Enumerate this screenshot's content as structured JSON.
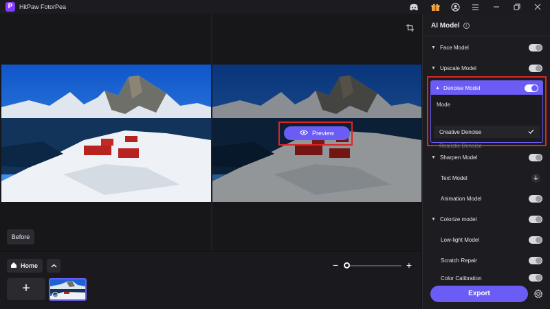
{
  "app": {
    "logo_letter": "P",
    "title": "HitPaw FotorPea"
  },
  "titlebar": {
    "icons": [
      "discord-icon",
      "gift-icon",
      "account-icon",
      "menu-icon",
      "minimize-icon",
      "maximize-icon",
      "close-icon"
    ]
  },
  "canvas": {
    "preview_label": "Preview",
    "before_label": "Before"
  },
  "bottom": {
    "home_label": "Home",
    "add_label": "+",
    "zoom_level": 0
  },
  "panel": {
    "title": "AI Model",
    "models": [
      {
        "label": "Face Model",
        "toggle": false
      },
      {
        "label": "Upscale Model",
        "toggle": false
      }
    ],
    "denoise": {
      "label": "Denoise Model",
      "toggle": true,
      "mode_label": "Mode",
      "options": [
        {
          "label": "Creative Denoise",
          "selected": true
        },
        {
          "label": "Realistic Denoise",
          "selected": false
        }
      ]
    },
    "sharpen": {
      "label": "Sharpen Model",
      "toggle": false
    },
    "text_model": {
      "label": "Text Model"
    },
    "animation": {
      "label": "Animation Model",
      "toggle": false
    },
    "colorize": {
      "label": "Colorize model",
      "toggle": false
    },
    "lowlight": {
      "label": "Low-light Model",
      "toggle": false
    },
    "scratch": {
      "label": "Scratch Repair",
      "toggle": false
    },
    "color_cal": {
      "label": "Color Calibration",
      "toggle": false
    },
    "export_label": "Export"
  },
  "colors": {
    "accent": "#6b5cf6",
    "highlight": "#e02424",
    "background": "#141417"
  }
}
